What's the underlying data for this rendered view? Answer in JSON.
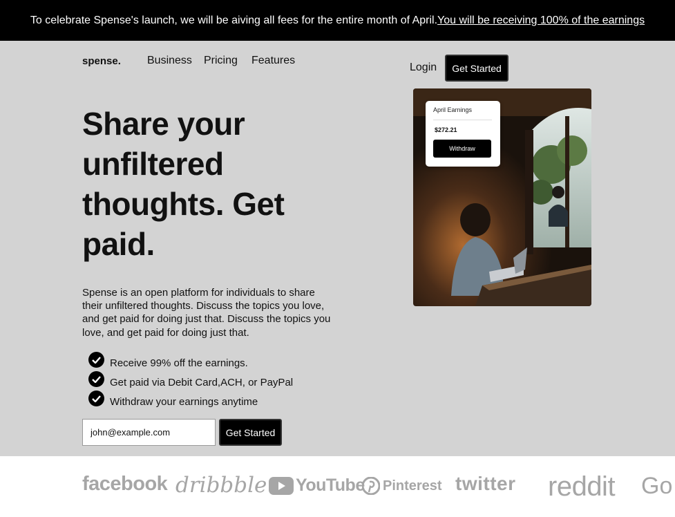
{
  "banner": {
    "text": "To celebrate Spense's launch, we will be aiving all fees for the entire month of April.",
    "link": "You will be receiving 100% of the earnings"
  },
  "nav": {
    "logo": "spense.",
    "links": [
      "Business",
      "Pricing",
      "Features"
    ],
    "login": "Login",
    "cta": "Get Started"
  },
  "hero": {
    "headline": "Share your unfiltered thoughts. Get paid.",
    "description": "Spense is an open platform for individuals to share their unfiltered thoughts. Discuss the topics you love, and get paid for doing just that. Discuss the topics you love, and get paid for doing just that.",
    "features": [
      "Receive 99% off the earnings.",
      "Get paid via Debit Card,ACH, or PayPal",
      "Withdraw your earnings anytime"
    ],
    "email_value": "john@example.com",
    "form_cta": "Get Started"
  },
  "earnings_card": {
    "title": "April Earnings",
    "amount": "$272.21",
    "button": "Withdraw"
  },
  "brands": [
    "facebook",
    "dribbble",
    "YouTube",
    "Pinterest",
    "twitter",
    "reddit",
    "Go"
  ],
  "colors": {
    "accent": "#000000",
    "hero_bg": "#d3d3d3",
    "brand_gray": "#a6a6a6"
  }
}
